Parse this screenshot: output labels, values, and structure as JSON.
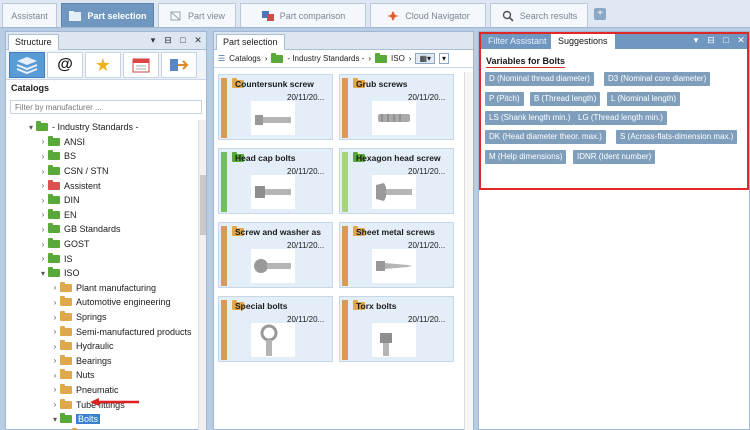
{
  "top_tabs": [
    {
      "label": "Assistant",
      "active": false
    },
    {
      "label": "Part selection",
      "active": true
    },
    {
      "label": "Part view",
      "active": false
    },
    {
      "label": "Part comparison",
      "active": false
    },
    {
      "label": "Cloud Navigator",
      "active": false
    },
    {
      "label": "Search results",
      "active": false
    }
  ],
  "add_tab": "+",
  "structure": {
    "title": "Structure",
    "catalogs_label": "Catalogs",
    "filter_placeholder": "Filter by manufacturer ...",
    "tree": [
      {
        "label": "- Industry Standards -",
        "arrow": "▾",
        "color": "green",
        "indent": 0
      },
      {
        "label": "ANSI",
        "arrow": "›",
        "color": "green",
        "indent": 1
      },
      {
        "label": "BS",
        "arrow": "›",
        "color": "green",
        "indent": 1
      },
      {
        "label": "CSN / STN",
        "arrow": "›",
        "color": "green",
        "indent": 1
      },
      {
        "label": "Assistent",
        "arrow": "›",
        "color": "red",
        "indent": 1
      },
      {
        "label": "DIN",
        "arrow": "›",
        "color": "green",
        "indent": 1
      },
      {
        "label": "EN",
        "arrow": "›",
        "color": "green",
        "indent": 1
      },
      {
        "label": "GB Standards",
        "arrow": "›",
        "color": "green",
        "indent": 1
      },
      {
        "label": "GOST",
        "arrow": "›",
        "color": "green",
        "indent": 1
      },
      {
        "label": "IS",
        "arrow": "›",
        "color": "green",
        "indent": 1
      },
      {
        "label": "ISO",
        "arrow": "▾",
        "color": "green",
        "indent": 1
      },
      {
        "label": "Plant manufacturing",
        "arrow": "›",
        "color": "orange",
        "indent": 2
      },
      {
        "label": "Automotive engineering",
        "arrow": "›",
        "color": "orange",
        "indent": 2
      },
      {
        "label": "Springs",
        "arrow": "›",
        "color": "orange",
        "indent": 2
      },
      {
        "label": "Semi-manufactured products",
        "arrow": "›",
        "color": "orange",
        "indent": 2
      },
      {
        "label": "Hydraulic",
        "arrow": "›",
        "color": "orange",
        "indent": 2
      },
      {
        "label": "Bearings",
        "arrow": "›",
        "color": "orange",
        "indent": 2
      },
      {
        "label": "Nuts",
        "arrow": "›",
        "color": "orange",
        "indent": 2
      },
      {
        "label": "Pneumatic",
        "arrow": "›",
        "color": "orange",
        "indent": 2
      },
      {
        "label": "Tube fittings",
        "arrow": "›",
        "color": "orange",
        "indent": 2
      },
      {
        "label": "Bolts",
        "arrow": "▾",
        "color": "green",
        "indent": 2,
        "selected": true
      },
      {
        "label": "Countersunk screw",
        "arrow": "›",
        "color": "orange",
        "indent": 3
      }
    ]
  },
  "part_selection": {
    "title": "Part selection",
    "breadcrumb": [
      "Catalogs",
      "- Industry Standards -",
      "ISO"
    ],
    "cards": [
      {
        "name": "Countersunk screw",
        "date": "20/11/20...",
        "strip": "#d99a55",
        "folder": "orange"
      },
      {
        "name": "Grub screws",
        "date": "20/11/20...",
        "strip": "#d99a55",
        "folder": "orange"
      },
      {
        "name": "Head cap bolts",
        "date": "20/11/20...",
        "strip": "#6fbf5a",
        "folder": "green"
      },
      {
        "name": "Hexagon head screw",
        "date": "20/11/20...",
        "strip": "#a8d37d",
        "folder": "green"
      },
      {
        "name": "Screw and washer as",
        "date": "20/11/20...",
        "strip": "#d99a55",
        "folder": "orange"
      },
      {
        "name": "Sheet metal screws",
        "date": "20/11/20...",
        "strip": "#d99a55",
        "folder": "orange"
      },
      {
        "name": "Special bolts",
        "date": "20/11/20...",
        "strip": "#d99a55",
        "folder": "orange"
      },
      {
        "name": "Torx bolts",
        "date": "20/11/20...",
        "strip": "#d99a55",
        "folder": "orange"
      }
    ]
  },
  "filter_panel": {
    "tabs": [
      {
        "label": "Filter Assistant",
        "active": false
      },
      {
        "label": "Suggestions",
        "active": true
      }
    ],
    "variables_title": "Variables for Bolts",
    "chips": [
      "D (Nominal thread diameter)",
      "D3 (Nominal core diameter)",
      "P (Pitch)",
      "B (Thread length)",
      "L (Nominal length)",
      "LS (Shank length min.)",
      "LG (Thread length min.)",
      "DK (Head diameter theor. max.)",
      "S (Across-flats-dimension max.)",
      "M (Help dimensions)",
      "IDNR (Ident number)"
    ]
  },
  "colors": {
    "accent": "#6f97bf",
    "highlight_box": "#e02828",
    "selection": "#3a7fd0"
  }
}
